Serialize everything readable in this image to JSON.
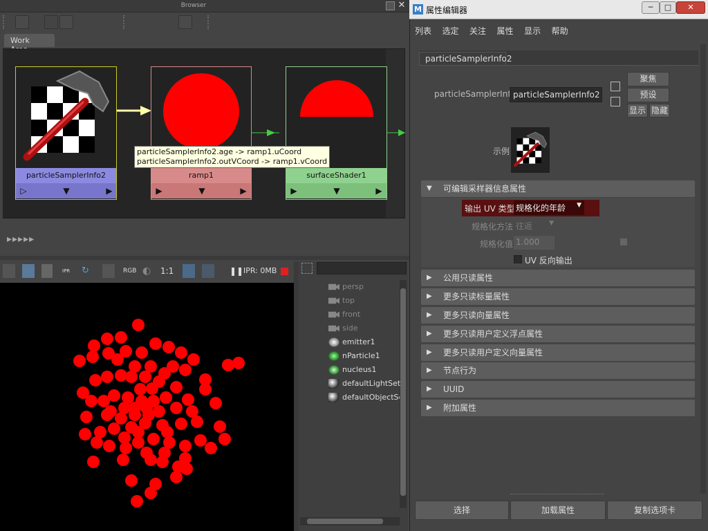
{
  "hypershade": {
    "browser_title": "Browser",
    "work_tab": "Work Area",
    "nodes": [
      {
        "name": "particleSamplerInfo2",
        "color": "#8b8ae0",
        "border": "#c9c92a"
      },
      {
        "name": "ramp1",
        "color": "#d88a8a",
        "border": "#d8898a"
      },
      {
        "name": "surfaceShader1",
        "color": "#8fd18f",
        "border": "#8fd18f"
      }
    ],
    "tooltip": [
      "particleSamplerInfo2.age -> ramp1.uCoord",
      "particleSamplerInfo2.outVCoord -> ramp1.vCoord"
    ],
    "bottom_arrows": "▸▸▸▸▸"
  },
  "viewport_bar": {
    "rgb": "RGB",
    "ratio": "1:1",
    "ipr": "IPR: 0MB"
  },
  "outliner": {
    "items": [
      {
        "label": "persp",
        "icon": "camera-icon",
        "dim": true
      },
      {
        "label": "top",
        "icon": "camera-icon",
        "dim": true
      },
      {
        "label": "front",
        "icon": "camera-icon",
        "dim": true
      },
      {
        "label": "side",
        "icon": "camera-icon",
        "dim": true
      },
      {
        "label": "emitter1",
        "icon": "emitter-icon",
        "dim": false
      },
      {
        "label": "nParticle1",
        "icon": "nparticle-icon",
        "dim": false
      },
      {
        "label": "nucleus1",
        "icon": "nucleus-icon",
        "dim": false
      },
      {
        "label": "defaultLightSet",
        "icon": "set-icon",
        "dim": false
      },
      {
        "label": "defaultObjectSet",
        "icon": "set-icon",
        "dim": false
      }
    ]
  },
  "attribute_editor": {
    "title": "属性编辑器",
    "menu": [
      "列表",
      "选定",
      "关注",
      "属性",
      "显示",
      "帮助"
    ],
    "tab": "particleSamplerInfo2",
    "node_label": "particleSamplerInfo:",
    "node_value": "particleSamplerInfo2",
    "buttons": {
      "focus": "聚焦",
      "preset": "预设",
      "show": "显示",
      "hide": "隐藏"
    },
    "sample_label": "示例",
    "expanded_section": "可编辑采样器信息属性",
    "output_uv_label": "输出 UV 类型",
    "output_uv_value": "规格化的年龄",
    "normalize_method_label": "规格化方法",
    "normalize_method_value": "往返",
    "normalize_value_label": "规格化值",
    "normalize_value_value": "1.000",
    "uv_reverse_label": "UV 反向输出",
    "sections": [
      "公用只读属性",
      "更多只读标量属性",
      "更多只读向量属性",
      "更多只读用户定义浮点属性",
      "更多只读用户定义向量属性",
      "节点行为",
      "UUID",
      "附加属性"
    ],
    "bottom": {
      "select": "选择",
      "load": "加载属性",
      "copy": "复制选项卡"
    }
  }
}
